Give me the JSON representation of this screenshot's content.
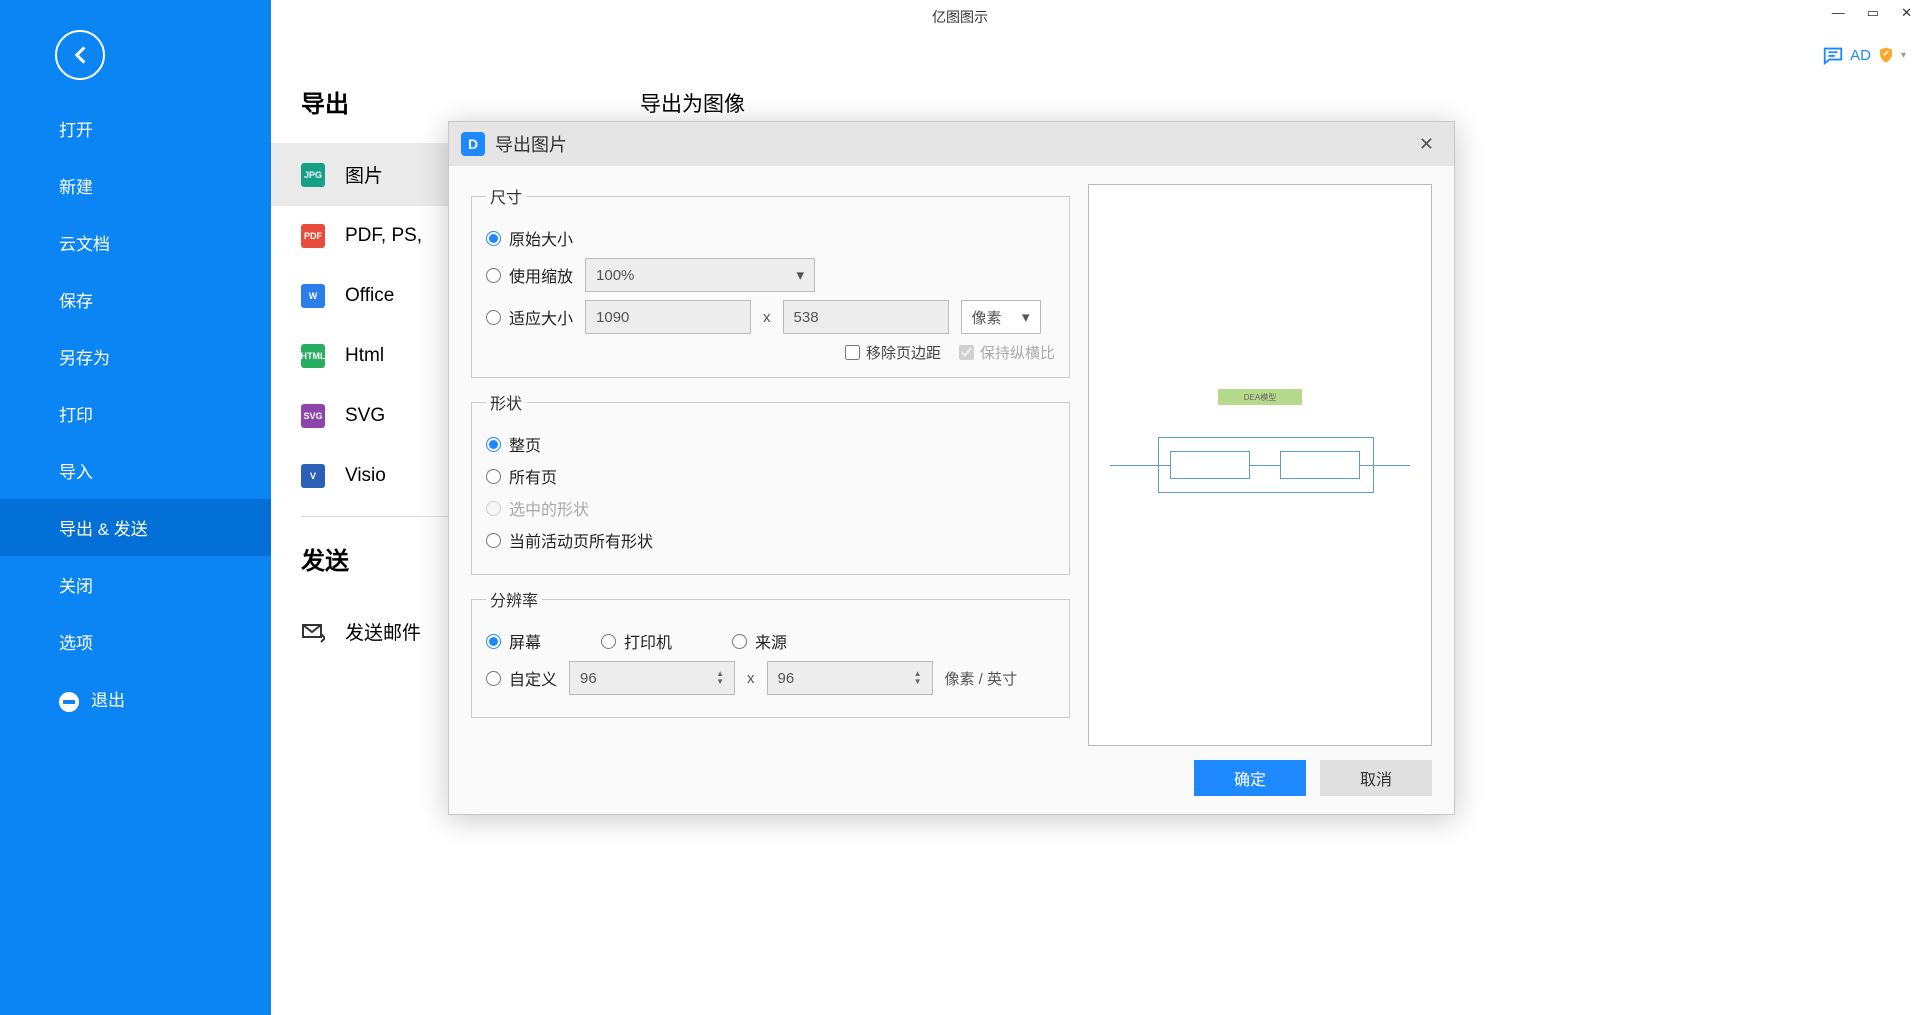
{
  "app": {
    "title": "亿图图示"
  },
  "window_controls": {
    "min": "—",
    "max": "▭",
    "close": "✕"
  },
  "badge": {
    "ad": "AD"
  },
  "sidebar": {
    "items": [
      {
        "label": "打开"
      },
      {
        "label": "新建"
      },
      {
        "label": "云文档"
      },
      {
        "label": "保存"
      },
      {
        "label": "另存为"
      },
      {
        "label": "打印"
      },
      {
        "label": "导入"
      },
      {
        "label": "导出 & 发送"
      },
      {
        "label": "关闭"
      },
      {
        "label": "选项"
      },
      {
        "label": "退出"
      }
    ]
  },
  "col2": {
    "heading_export": "导出",
    "heading_send": "发送",
    "items": {
      "image": "图片",
      "pdf": "PDF, PS,",
      "office": "Office",
      "html": "Html",
      "svg": "SVG",
      "visio": "Visio"
    },
    "send_mail": "发送邮件"
  },
  "col3": {
    "header": "导出为图像"
  },
  "modal": {
    "title": "导出图片",
    "size": {
      "legend": "尺寸",
      "original": "原始大小",
      "zoom": "使用缩放",
      "zoom_value": "100%",
      "fit": "适应大小",
      "width": "1090",
      "height": "538",
      "unit": "像素",
      "remove_margin": "移除页边距",
      "keep_ratio": "保持纵横比"
    },
    "shape": {
      "legend": "形状",
      "full_page": "整页",
      "all_pages": "所有页",
      "selected": "选中的形状",
      "all_shapes_active": "当前活动页所有形状"
    },
    "resolution": {
      "legend": "分辨率",
      "screen": "屏幕",
      "printer": "打印机",
      "source": "来源",
      "custom": "自定义",
      "dpi_x": "96",
      "dpi_y": "96",
      "unit": "像素 / 英寸"
    },
    "preview": {
      "title_box": "DEA模型"
    },
    "buttons": {
      "ok": "确定",
      "cancel": "取消"
    }
  }
}
